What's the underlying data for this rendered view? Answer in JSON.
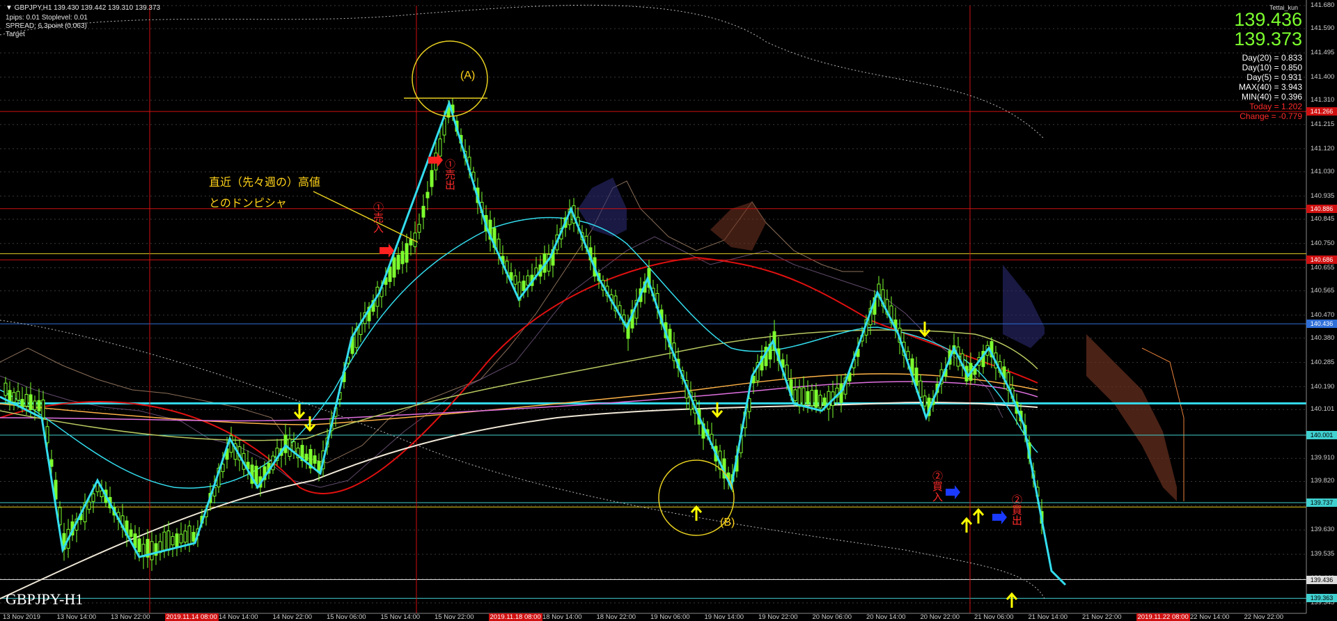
{
  "header": {
    "line1": "▼ GBPJPY,H1  139.430 139.442 139.310 139.373",
    "line2": "1pips: 0.01  Stoplevel: 0.01",
    "line3": "SPREAD: 6.3point (0.063)",
    "line4": "Target",
    "brand": "Tettai_kun"
  },
  "prices": {
    "bid": "139.436",
    "ask": "139.373"
  },
  "indicators": [
    {
      "text": "Day(20) = 0.833",
      "color": "#ffffff"
    },
    {
      "text": "Day(10) = 0.850",
      "color": "#ffffff"
    },
    {
      "text": "Day(5) = 0.931",
      "color": "#ffffff"
    },
    {
      "text": "MAX(40) = 3.943",
      "color": "#ffffff"
    },
    {
      "text": "MIN(40) = 0.396",
      "color": "#ffffff"
    },
    {
      "text": "Today = 1.202",
      "color": "#ff2a2a"
    },
    {
      "text": "Change = -0.779",
      "color": "#ff2a2a"
    }
  ],
  "price_axis": [
    "141.680",
    "141.590",
    "141.495",
    "141.400",
    "141.310",
    "141.215",
    "141.120",
    "141.030",
    "140.935",
    "140.845",
    "140.750",
    "140.655",
    "140.565",
    "140.470",
    "140.380",
    "140.285",
    "140.190",
    "140.101",
    "140.001",
    "139.910",
    "139.820",
    "139.725",
    "139.630",
    "139.535",
    "139.440",
    "139.345"
  ],
  "price_tags": [
    {
      "text": "141.266",
      "color": "#d01010",
      "price": 141.266
    },
    {
      "text": "140.886",
      "color": "#d01010",
      "price": 140.886
    },
    {
      "text": "140.686",
      "color": "#d01010",
      "price": 140.686
    },
    {
      "text": "140.436",
      "color": "#2f6fd8",
      "price": 140.436
    },
    {
      "text": "140.001",
      "color": "#40d0d0",
      "price": 140.001
    },
    {
      "text": "139.737",
      "color": "#40d0d0",
      "price": 139.737
    },
    {
      "text": "139.436",
      "color": "#dddddd",
      "price": 139.436
    },
    {
      "text": "139.363",
      "color": "#40d0d0",
      "price": 139.363
    }
  ],
  "time_axis": [
    {
      "text": "13 Nov 2019",
      "hl": false
    },
    {
      "text": "13 Nov 14:00",
      "hl": false
    },
    {
      "text": "13 Nov 22:00",
      "hl": false
    },
    {
      "text": "2019.11.14 08:00",
      "hl": true
    },
    {
      "text": "14 Nov 14:00",
      "hl": false
    },
    {
      "text": "14 Nov 22:00",
      "hl": false
    },
    {
      "text": "15 Nov 06:00",
      "hl": false
    },
    {
      "text": "15 Nov 14:00",
      "hl": false
    },
    {
      "text": "15 Nov 22:00",
      "hl": false
    },
    {
      "text": "2019.11.18 08:00",
      "hl": true
    },
    {
      "text": "18 Nov 14:00",
      "hl": false
    },
    {
      "text": "18 Nov 22:00",
      "hl": false
    },
    {
      "text": "19 Nov 06:00",
      "hl": false
    },
    {
      "text": "19 Nov 14:00",
      "hl": false
    },
    {
      "text": "19 Nov 22:00",
      "hl": false
    },
    {
      "text": "20 Nov 06:00",
      "hl": false
    },
    {
      "text": "20 Nov 14:00",
      "hl": false
    },
    {
      "text": "20 Nov 22:00",
      "hl": false
    },
    {
      "text": "21 Nov 06:00",
      "hl": false
    },
    {
      "text": "21 Nov 14:00",
      "hl": false
    },
    {
      "text": "21 Nov 22:00",
      "hl": false
    },
    {
      "text": "2019.11.22 08:00",
      "hl": true
    },
    {
      "text": "22 Nov 14:00",
      "hl": false
    },
    {
      "text": "22 Nov 22:00",
      "hl": false
    }
  ],
  "annotations": {
    "a_label": "(A)",
    "b_label": "(B)",
    "note_line1": "直近（先々週の）高値",
    "note_line2": "とのドンピシャ",
    "buy1": "①売入",
    "sell1": "①売出",
    "buy2": "②買入",
    "sell2": "②買出"
  },
  "symbol_label": "GBPJPY-H1",
  "colors": {
    "bull": "#7cff2e",
    "cyan": "#33ddee",
    "yellow": "#ffff40",
    "red": "#e01010",
    "grid": "#4a4a4a"
  }
}
